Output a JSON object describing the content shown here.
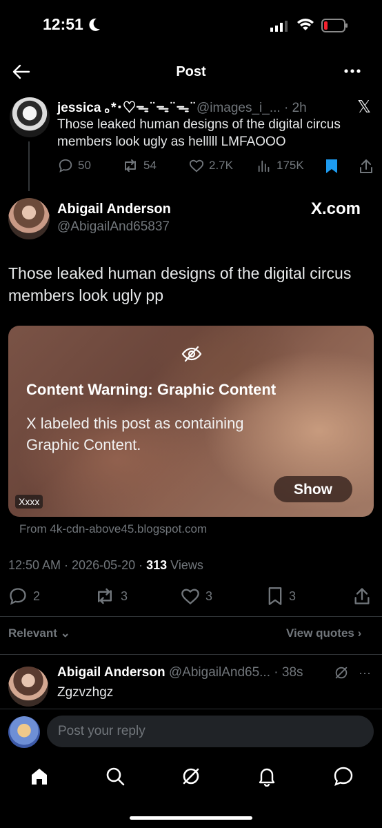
{
  "status_bar": {
    "time": "12:51"
  },
  "header": {
    "title": "Post"
  },
  "quoted_tweet": {
    "name": "jessica ｡*･♡ᯓ ̈ ᯓ ̈ ᯓ ̈",
    "handle": "@images_i_...",
    "time": "· 2h",
    "text": "Those leaked human designs of the digital circus members look ugly as helllll LMFAOOO",
    "replies": "50",
    "reposts": "54",
    "likes": "2.7K",
    "views": "175K"
  },
  "main_tweet": {
    "name": "Abigail Anderson",
    "handle": "@AbigailAnd65837",
    "source_badge": "X.com",
    "text": "Those leaked human designs of the digital circus members look ugly pp",
    "media": {
      "warning_title": "Content Warning: Graphic Content",
      "warning_body": "X labeled this post as containing Graphic Content.",
      "show_label": "Show",
      "badge": "Xxxx"
    },
    "link_source": "From 4k-cdn-above45.blogspot.com",
    "timestamp": "12:50 AM · 2026-05-20 · ",
    "views_count": "313",
    "views_label": " Views",
    "replies": "2",
    "reposts": "3",
    "likes": "3",
    "bookmarks": "3"
  },
  "filters": {
    "relevant": "Relevant",
    "view_quotes": "View quotes"
  },
  "reply": {
    "name": "Abigail Anderson",
    "handle": "@AbigailAnd65...",
    "time": "· 38s",
    "text": "Zgzvzhgz"
  },
  "composer": {
    "placeholder": "Post your reply"
  },
  "colors": {
    "background": "#000000",
    "accent": "#1d9bf0",
    "muted": "#71767b",
    "battery_low": "#f4212e"
  }
}
